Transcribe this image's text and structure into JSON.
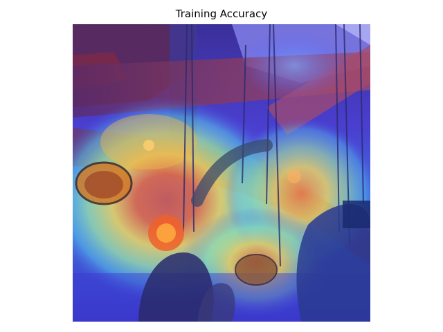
{
  "figure": {
    "title": "Training Accuracy"
  },
  "image": {
    "description_icon": "heatmap-overlay-image",
    "colormap": "jet",
    "colors": {
      "overlay_blue": "#3a3cf0",
      "overlay_cyan": "#4fd8e8",
      "overlay_yellow": "#f4e85a",
      "overlay_red": "#e0483a",
      "overlay_dark_red": "#9a2a3a",
      "background": "#ffffff"
    }
  }
}
